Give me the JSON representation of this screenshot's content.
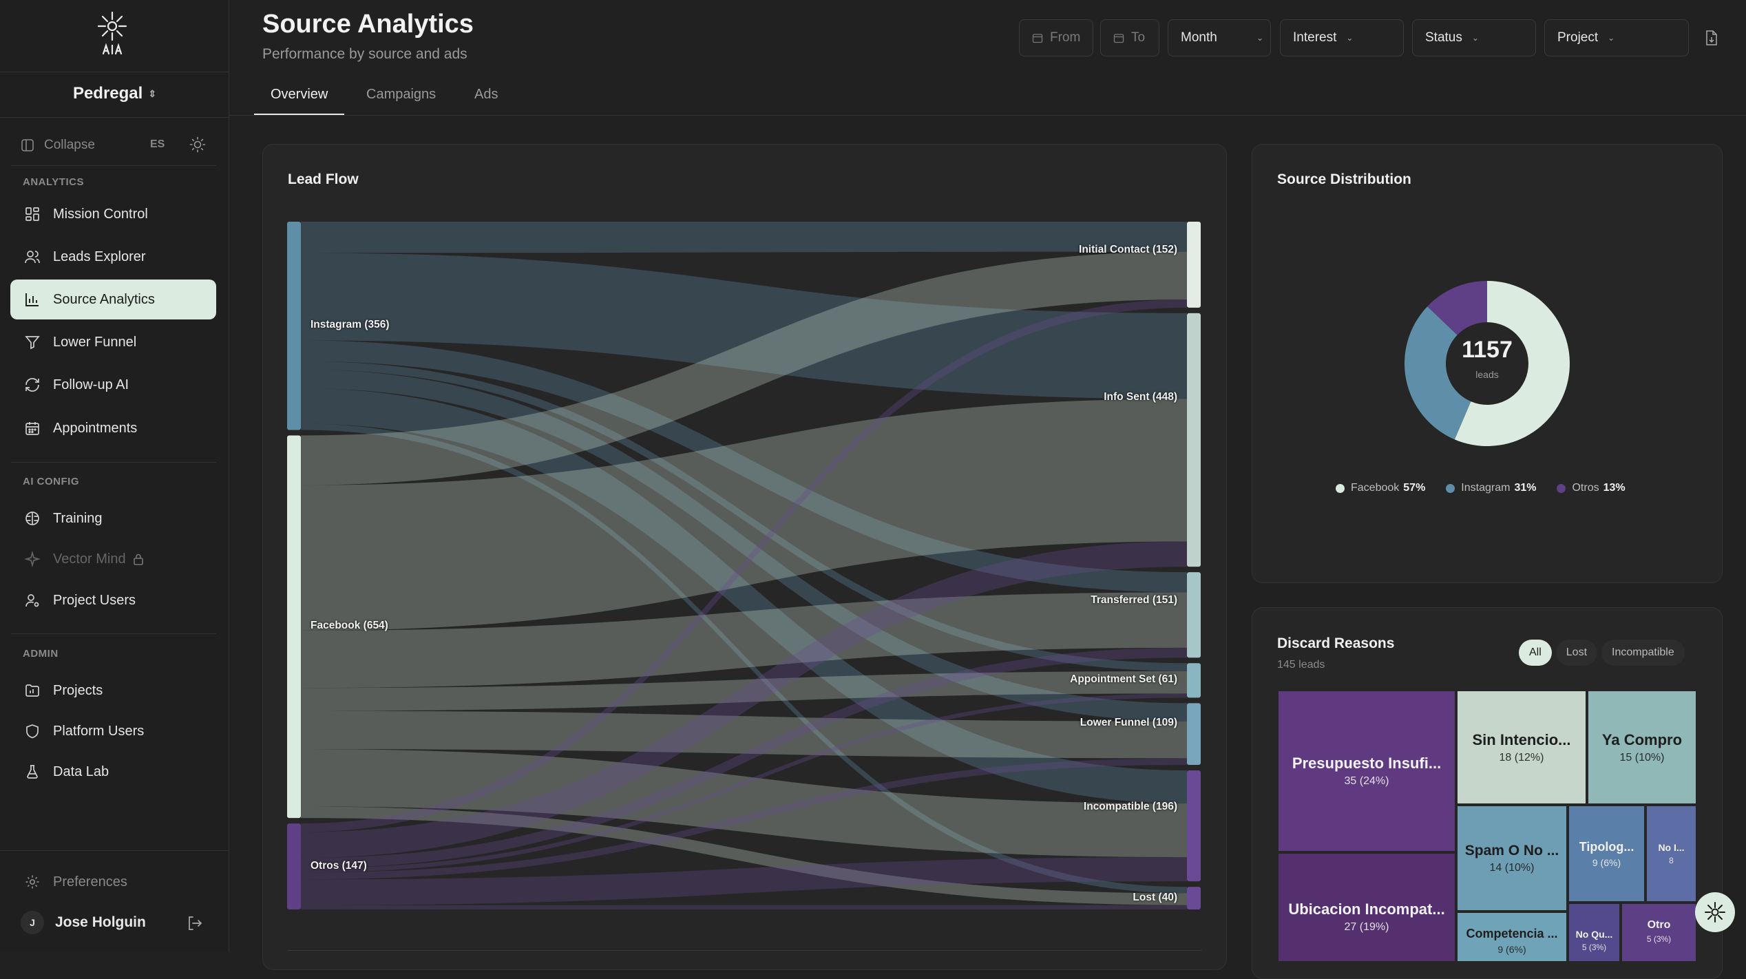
{
  "app": {
    "title": "Source Analytics",
    "subtitle": "Performance by source and ads"
  },
  "sidebar": {
    "project": "Pedregal",
    "collapse_label": "Collapse",
    "lang": "ES",
    "sections": [
      {
        "label": "ANALYTICS",
        "items": [
          {
            "label": "Mission Control",
            "icon": "grid-icon"
          },
          {
            "label": "Leads Explorer",
            "icon": "users-icon"
          },
          {
            "label": "Source Analytics",
            "icon": "bar-chart-icon",
            "active": true
          },
          {
            "label": "Lower Funnel",
            "icon": "funnel-icon"
          },
          {
            "label": "Follow-up AI",
            "icon": "refresh-icon"
          },
          {
            "label": "Appointments",
            "icon": "calendar-icon"
          }
        ]
      },
      {
        "label": "AI CONFIG",
        "items": [
          {
            "label": "Training",
            "icon": "brain-icon"
          },
          {
            "label": "Vector Mind",
            "icon": "sparkle-icon",
            "disabled": true
          },
          {
            "label": "Project Users",
            "icon": "user-gear-icon"
          }
        ]
      },
      {
        "label": "ADMIN",
        "items": [
          {
            "label": "Projects",
            "icon": "folder-chart-icon"
          },
          {
            "label": "Platform Users",
            "icon": "shield-icon"
          },
          {
            "label": "Data Lab",
            "icon": "flask-icon"
          }
        ]
      }
    ],
    "preferences_label": "Preferences",
    "user": {
      "initial": "J",
      "name": "Jose Holguin"
    }
  },
  "filters": {
    "from": "From",
    "to": "To",
    "period": "Month",
    "interest": "Interest",
    "status": "Status",
    "project": "Project"
  },
  "tabs": [
    "Overview",
    "Campaigns",
    "Ads"
  ],
  "lead_flow": {
    "title": "Lead Flow",
    "sources": [
      {
        "name": "Instagram",
        "label": "Instagram (356)",
        "value": 356,
        "color": "#5f8fa8"
      },
      {
        "name": "Facebook",
        "label": "Facebook (654)",
        "value": 654,
        "color": "#dcebe0"
      },
      {
        "name": "Otros",
        "label": "Otros (147)",
        "value": 147,
        "color": "#5f3f86"
      }
    ],
    "targets": [
      {
        "name": "Initial Contact",
        "label": "Initial Contact (152)",
        "value": 152
      },
      {
        "name": "Info Sent",
        "label": "Info Sent (448)",
        "value": 448
      },
      {
        "name": "Transferred",
        "label": "Transferred (151)",
        "value": 151
      },
      {
        "name": "Appointment Set",
        "label": "Appointment Set (61)",
        "value": 61
      },
      {
        "name": "Lower Funnel",
        "label": "Lower Funnel (109)",
        "value": 109
      },
      {
        "name": "Incompatible",
        "label": "Incompatible (196)",
        "value": 196
      },
      {
        "name": "Lost",
        "label": "Lost (40)",
        "value": 40
      }
    ]
  },
  "source_distribution": {
    "title": "Source Distribution",
    "total": "1157",
    "total_label": "leads",
    "slices": [
      {
        "name": "Facebook",
        "pct": "57%",
        "value": 57,
        "color": "#dcebe0"
      },
      {
        "name": "Instagram",
        "pct": "31%",
        "value": 31,
        "color": "#5f8fa8"
      },
      {
        "name": "Otros",
        "pct": "13%",
        "value": 13,
        "color": "#5f3f86"
      }
    ]
  },
  "discard_reasons": {
    "title": "Discard Reasons",
    "count": "145 leads",
    "filters": [
      "All",
      "Lost",
      "Incompatible"
    ],
    "items": [
      {
        "name": "Presupuesto Insuficiente",
        "short": "Presupuesto Insufi...",
        "value": "35 (24%)",
        "color": "#5f3a80"
      },
      {
        "name": "Ubicacion Incompatible",
        "short": "Ubicacion Incompat...",
        "value": "27 (19%)",
        "color": "#55306f"
      },
      {
        "name": "Sin Intencion",
        "short": "Sin Intencio...",
        "value": "18 (12%)",
        "color": "#c6d6cb"
      },
      {
        "name": "Ya Compro",
        "short": "Ya Compro",
        "value": "15 (10%)",
        "color": "#8fb8b6"
      },
      {
        "name": "Spam O No",
        "short": "Spam O No ...",
        "value": "14 (10%)",
        "color": "#6d9eb3"
      },
      {
        "name": "Competencia",
        "short": "Competencia ...",
        "value": "9 (6%)",
        "color": "#6fa3b8"
      },
      {
        "name": "Tipologia",
        "short": "Tipolog...",
        "value": "9 (6%)",
        "color": "#5a7fa8"
      },
      {
        "name": "No I...",
        "short": "No I...",
        "value": "8",
        "color": "#5d6ea6"
      },
      {
        "name": "No Qu...",
        "short": "No Qu...",
        "value": "5 (3%)",
        "color": "#524a8c"
      },
      {
        "name": "Otro",
        "short": "Otro",
        "value": "5 (3%)",
        "color": "#5d3f86"
      }
    ]
  }
}
